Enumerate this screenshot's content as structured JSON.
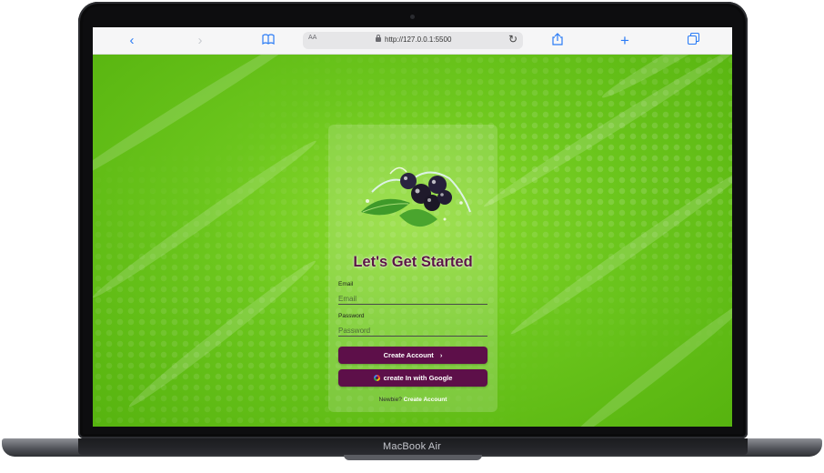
{
  "device": {
    "model": "MacBook Air"
  },
  "browser": {
    "text_size_label": "AA",
    "url": "http://127.0.0.1:5500",
    "icons": {
      "back": "chevron-left-icon",
      "forward": "chevron-right-icon",
      "bookmarks": "book-icon",
      "lock": "lock-icon",
      "reload": "reload-icon",
      "share": "share-icon",
      "new_tab": "plus-icon",
      "tabs": "tabs-icon"
    }
  },
  "login": {
    "title": "Let's Get Started",
    "email": {
      "label": "Email",
      "placeholder": "Email",
      "value": ""
    },
    "password": {
      "label": "Password",
      "placeholder": "Password",
      "value": ""
    },
    "create_account_button": "Create Account",
    "create_account_arrow": "›",
    "google_button": "create In with Google",
    "footer_prompt": "Newbie?",
    "footer_link": "Create Account"
  },
  "colors": {
    "background_green": "#6cc61d",
    "accent_purple": "#5d0f49",
    "browser_blue": "#2b7cf6"
  }
}
